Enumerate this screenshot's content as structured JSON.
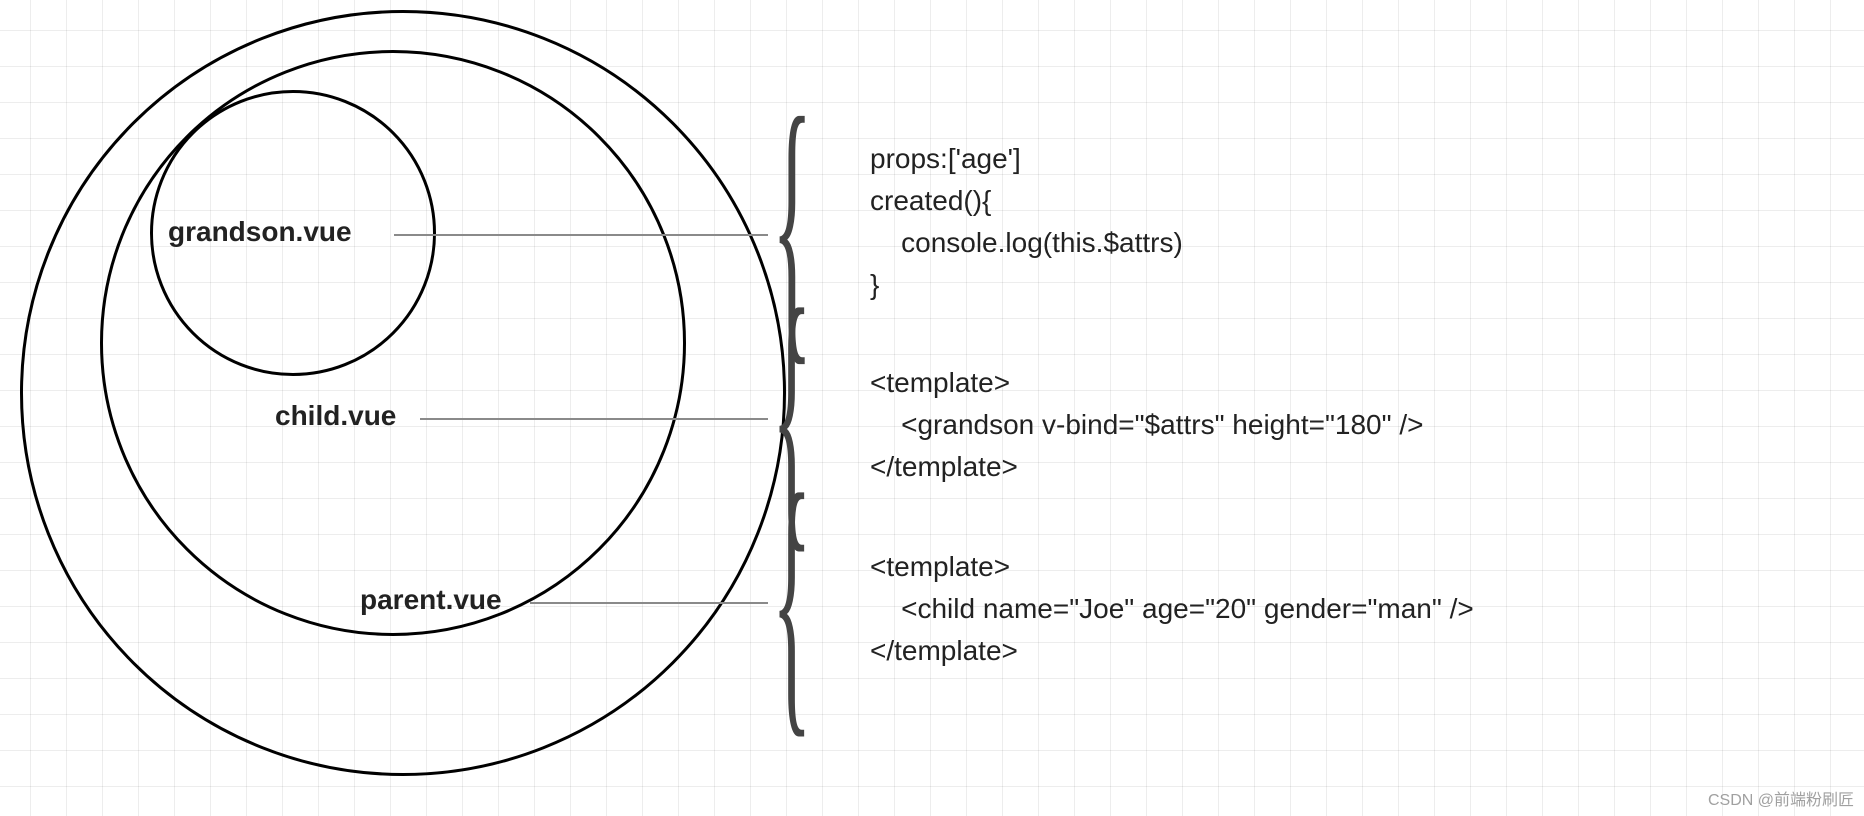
{
  "diagram": {
    "labels": {
      "outer": "parent.vue",
      "middle": "child.vue",
      "inner": "grandson.vue"
    },
    "snippets": {
      "grandson": "props:['age']\ncreated(){\n    console.log(this.$attrs)\n}",
      "child": "<template>\n    <grandson v-bind=\"$attrs\" height=\"180\" />\n</template>",
      "parent": "<template>\n    <child name=\"Joe\" age=\"20\" gender=\"man\" />\n</template>"
    }
  },
  "watermark": "CSDN @前端粉刷匠"
}
